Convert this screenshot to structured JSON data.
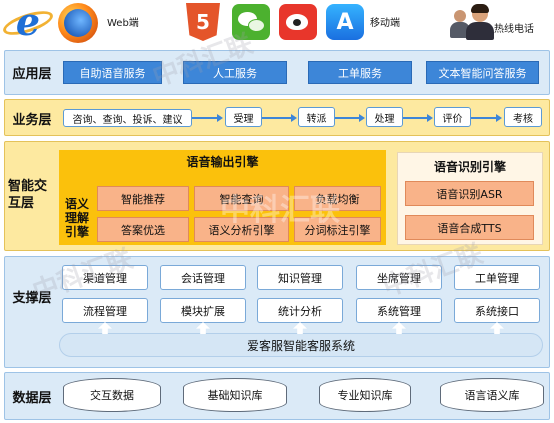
{
  "channels": {
    "web_label": "Web端",
    "html5_glyph": "5",
    "appstore_glyph": "A",
    "mobile_label": "移动端",
    "phone_label": "热线电话"
  },
  "layers": {
    "application": {
      "label": "应用层",
      "items": [
        "自助语音服务",
        "人工服务",
        "工单服务",
        "文本智能问答服务"
      ]
    },
    "business": {
      "label": "业务层",
      "items": [
        "咨询、查询、投诉、建议",
        "受理",
        "转派",
        "处理",
        "评价",
        "考核"
      ]
    },
    "interaction": {
      "label_line1": "智能交",
      "label_line2": "互层",
      "output_engine_title": "语音输出引擎",
      "semantic_engine_label": "语义理解引擎",
      "output_cells": [
        "智能推荐",
        "智能查询",
        "负载均衡",
        "答案优选",
        "语义分析引擎",
        "分词标注引擎"
      ],
      "recognition_title": "语音识别引擎",
      "recognition_cells": [
        "语音识别ASR",
        "语音合成TTS"
      ]
    },
    "support": {
      "label": "支撑层",
      "row1": [
        "渠道管理",
        "会话管理",
        "知识管理",
        "坐席管理",
        "工单管理"
      ],
      "row2": [
        "流程管理",
        "模块扩展",
        "统计分析",
        "系统管理",
        "系统接口"
      ],
      "platform": "爱客服智能客服系统"
    },
    "data": {
      "label": "数据层",
      "items": [
        "交互数据",
        "基础知识库",
        "专业知识库",
        "语言语义库"
      ]
    }
  },
  "watermark": "中科汇联",
  "colors": {
    "blue_button": "#3d86d8",
    "yellow_band": "#fde9a0",
    "engine_orange": "#fbc10c",
    "cell_salmon": "#f9b389",
    "light_blue_band": "#dbeaf7"
  }
}
